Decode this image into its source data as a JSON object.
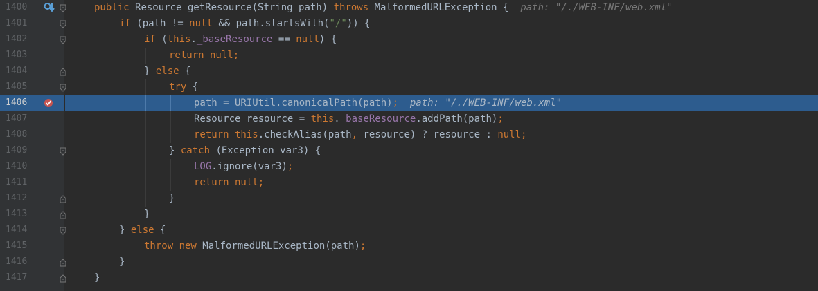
{
  "editor": {
    "colors": {
      "background": "#2b2b2b",
      "gutter": "#313335",
      "highlight": "#2d5c8e",
      "keyword": "#cc7832",
      "string": "#6a8759",
      "field": "#9876aa",
      "text": "#a9b7c6",
      "hint": "#787878"
    },
    "gutter_icons": {
      "line_1400": "step-into-marker-icon",
      "line_1406": "breakpoint-icon"
    },
    "lines": [
      {
        "num": "1400",
        "indent": 1,
        "fold": "open",
        "tokens": [
          {
            "t": "public ",
            "c": "kw"
          },
          {
            "t": "Resource getResource(String path) ",
            "c": ""
          },
          {
            "t": "throws ",
            "c": "kw"
          },
          {
            "t": "MalformedURLException {  ",
            "c": ""
          },
          {
            "t": "path: \"/./WEB-INF/web.xml\"",
            "c": "hint"
          }
        ]
      },
      {
        "num": "1401",
        "indent": 2,
        "fold": "open",
        "tokens": [
          {
            "t": "if ",
            "c": "kw"
          },
          {
            "t": "(path != ",
            "c": ""
          },
          {
            "t": "null ",
            "c": "kw"
          },
          {
            "t": "&& path.startsWith(",
            "c": ""
          },
          {
            "t": "\"/\"",
            "c": "str"
          },
          {
            "t": ")) {",
            "c": ""
          }
        ]
      },
      {
        "num": "1402",
        "indent": 3,
        "fold": "open",
        "tokens": [
          {
            "t": "if ",
            "c": "kw"
          },
          {
            "t": "(",
            "c": ""
          },
          {
            "t": "this",
            "c": "kw"
          },
          {
            "t": ".",
            "c": ""
          },
          {
            "t": "_baseResource",
            "c": "field"
          },
          {
            "t": " == ",
            "c": ""
          },
          {
            "t": "null",
            "c": "kw"
          },
          {
            "t": ") {",
            "c": ""
          }
        ]
      },
      {
        "num": "1403",
        "indent": 4,
        "fold": "",
        "tokens": [
          {
            "t": "return null",
            "c": "kw"
          },
          {
            "t": ";",
            "c": "kw"
          }
        ]
      },
      {
        "num": "1404",
        "indent": 3,
        "fold": "close",
        "tokens": [
          {
            "t": "} ",
            "c": ""
          },
          {
            "t": "else ",
            "c": "kw"
          },
          {
            "t": "{",
            "c": ""
          }
        ]
      },
      {
        "num": "1405",
        "indent": 4,
        "fold": "open",
        "tokens": [
          {
            "t": "try ",
            "c": "kw"
          },
          {
            "t": "{",
            "c": ""
          }
        ]
      },
      {
        "num": "1406",
        "indent": 5,
        "fold": "",
        "highlight": true,
        "tokens": [
          {
            "t": "path = URIUtil.canonicalPath(path)",
            "c": ""
          },
          {
            "t": ";  ",
            "c": "kw"
          },
          {
            "t": "path: \"/./WEB-INF/web.xml\"",
            "c": "hint"
          }
        ]
      },
      {
        "num": "1407",
        "indent": 5,
        "fold": "",
        "tokens": [
          {
            "t": "Resource resource = ",
            "c": ""
          },
          {
            "t": "this",
            "c": "kw"
          },
          {
            "t": ".",
            "c": ""
          },
          {
            "t": "_baseResource",
            "c": "field"
          },
          {
            "t": ".addPath(path)",
            "c": ""
          },
          {
            "t": ";",
            "c": "kw"
          }
        ]
      },
      {
        "num": "1408",
        "indent": 5,
        "fold": "",
        "tokens": [
          {
            "t": "return this",
            "c": "kw"
          },
          {
            "t": ".checkAlias(path",
            "c": ""
          },
          {
            "t": ", ",
            "c": "kw"
          },
          {
            "t": "resource) ? resource : ",
            "c": ""
          },
          {
            "t": "null;",
            "c": "kw"
          }
        ]
      },
      {
        "num": "1409",
        "indent": 4,
        "fold": "open",
        "tokens": [
          {
            "t": "} ",
            "c": ""
          },
          {
            "t": "catch ",
            "c": "kw"
          },
          {
            "t": "(Exception var3) {",
            "c": ""
          }
        ]
      },
      {
        "num": "1410",
        "indent": 5,
        "fold": "",
        "tokens": [
          {
            "t": "LOG",
            "c": "field"
          },
          {
            "t": ".ignore(var3)",
            "c": ""
          },
          {
            "t": ";",
            "c": "kw"
          }
        ]
      },
      {
        "num": "1411",
        "indent": 5,
        "fold": "",
        "tokens": [
          {
            "t": "return null",
            "c": "kw"
          },
          {
            "t": ";",
            "c": "kw"
          }
        ]
      },
      {
        "num": "1412",
        "indent": 4,
        "fold": "close",
        "tokens": [
          {
            "t": "}",
            "c": ""
          }
        ]
      },
      {
        "num": "1413",
        "indent": 3,
        "fold": "close",
        "tokens": [
          {
            "t": "}",
            "c": ""
          }
        ]
      },
      {
        "num": "1414",
        "indent": 2,
        "fold": "open",
        "tokens": [
          {
            "t": "} ",
            "c": ""
          },
          {
            "t": "else ",
            "c": "kw"
          },
          {
            "t": "{",
            "c": ""
          }
        ]
      },
      {
        "num": "1415",
        "indent": 3,
        "fold": "",
        "tokens": [
          {
            "t": "throw new ",
            "c": "kw"
          },
          {
            "t": "MalformedURLException(path)",
            "c": ""
          },
          {
            "t": ";",
            "c": "kw"
          }
        ]
      },
      {
        "num": "1416",
        "indent": 2,
        "fold": "close",
        "tokens": [
          {
            "t": "}",
            "c": ""
          }
        ]
      },
      {
        "num": "1417",
        "indent": 1,
        "fold": "close",
        "tokens": [
          {
            "t": "}",
            "c": ""
          }
        ]
      }
    ]
  }
}
